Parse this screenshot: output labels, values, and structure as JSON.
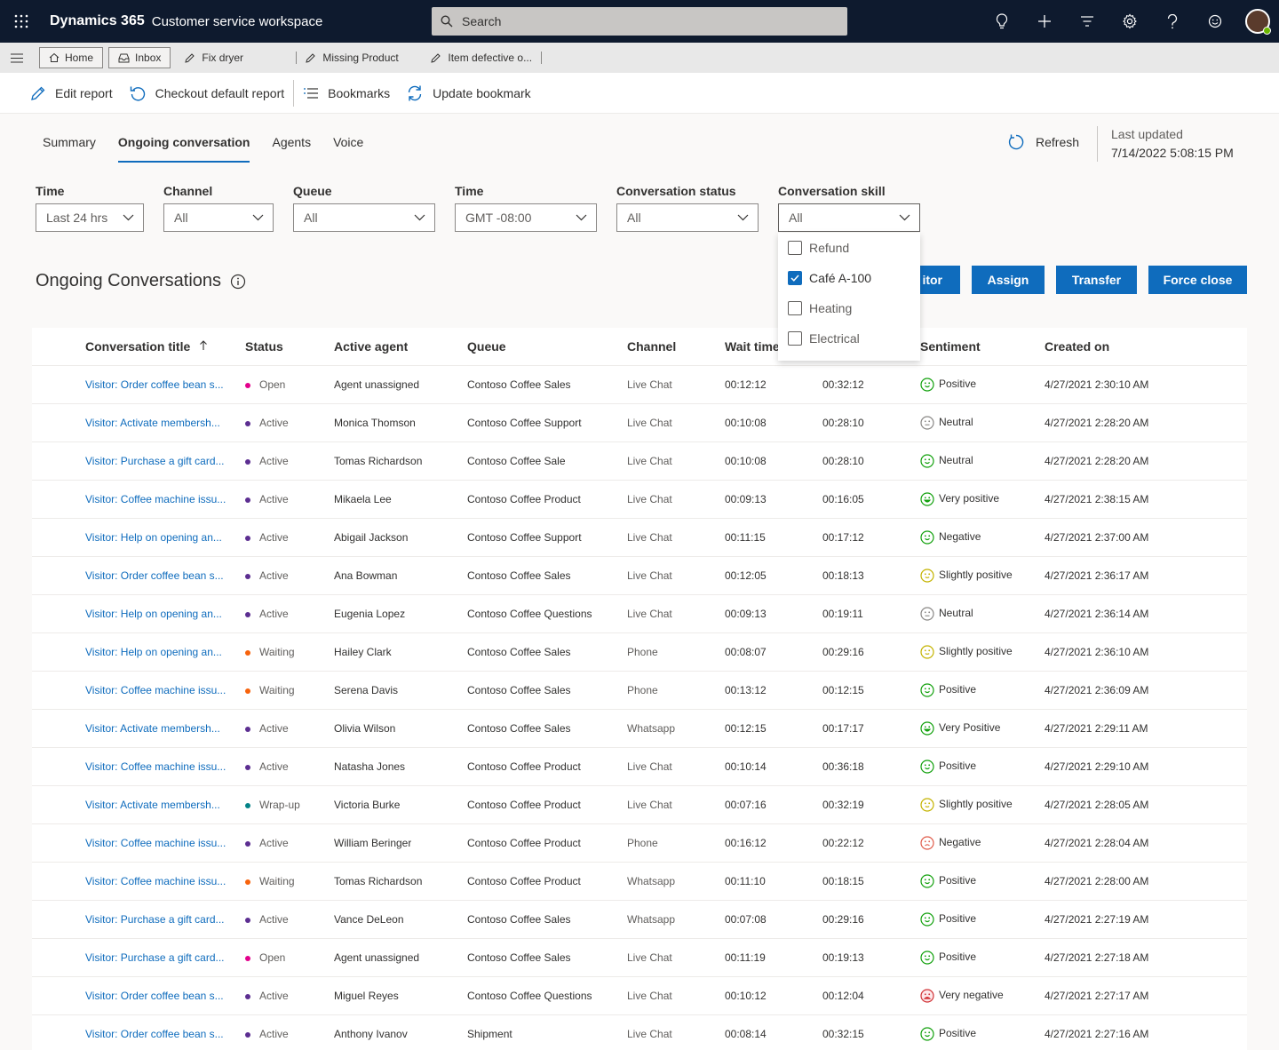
{
  "app": {
    "brand": "Dynamics 365",
    "name": "Customer service workspace"
  },
  "search": {
    "placeholder": "Search"
  },
  "session_tabs": {
    "home": "Home",
    "inbox": "Inbox",
    "sessions": [
      "Fix dryer",
      "Missing Product",
      "Item defective o..."
    ]
  },
  "commands": {
    "edit_report": "Edit report",
    "checkout_default": "Checkout default report",
    "bookmarks": "Bookmarks",
    "update_bookmark": "Update bookmark"
  },
  "pivots": [
    "Summary",
    "Ongoing conversation",
    "Agents",
    "Voice"
  ],
  "refresh": {
    "label": "Refresh",
    "last_updated_label": "Last updated",
    "last_updated_value": "7/14/2022 5:08:15 PM"
  },
  "filters": [
    {
      "label": "Time",
      "value": "Last 24 hrs"
    },
    {
      "label": "Channel",
      "value": "All"
    },
    {
      "label": "Queue",
      "value": "All"
    },
    {
      "label": "Time",
      "value": "GMT -08:00"
    },
    {
      "label": "Conversation status",
      "value": "All"
    },
    {
      "label": "Conversation skill",
      "value": "All"
    }
  ],
  "skill_options": [
    {
      "label": "Refund",
      "checked": false
    },
    {
      "label": "Café A-100",
      "checked": true
    },
    {
      "label": "Heating",
      "checked": false
    },
    {
      "label": "Electrical",
      "checked": false
    }
  ],
  "section": {
    "title": "Ongoing Conversations"
  },
  "actions": {
    "monitor": "itor",
    "assign": "Assign",
    "transfer": "Transfer",
    "force_close": "Force close"
  },
  "columns": [
    "Conversation title",
    "Status",
    "Active agent",
    "Queue",
    "Channel",
    "Wait time",
    "",
    "Sentiment",
    "Created on"
  ],
  "status_colors": {
    "Open": "#e3008c",
    "Active": "#5c2e91",
    "Waiting": "#f7630c",
    "Wrap-up": "#038387"
  },
  "sentiment_colors": {
    "positive": "#13a10e",
    "neutral": "#8a8886",
    "slight": "#c4b300",
    "negative": "#e05c4b",
    "very_negative": "#d13438"
  },
  "rows": [
    {
      "title": "Visitor: Order coffee bean s...",
      "status": "Open",
      "agent": "Agent unassigned",
      "queue": "Contoso Coffee Sales",
      "channel": "Live Chat",
      "wait": "00:12:12",
      "handle": "00:32:12",
      "sentiment": "Positive",
      "face": "positive",
      "created": "4/27/2021 2:30:10 AM"
    },
    {
      "title": "Visitor: Activate membersh...",
      "status": "Active",
      "agent": "Monica Thomson",
      "queue": "Contoso Coffee Support",
      "channel": "Live Chat",
      "wait": "00:10:08",
      "handle": "00:28:10",
      "sentiment": "Neutral",
      "face": "neutral",
      "created": "4/27/2021 2:28:20 AM"
    },
    {
      "title": "Visitor: Purchase a gift card...",
      "status": "Active",
      "agent": "Tomas Richardson",
      "queue": "Contoso Coffee Sale",
      "channel": "Live Chat",
      "wait": "00:10:08",
      "handle": "00:28:10",
      "sentiment": "Neutral",
      "face": "positive",
      "created": "4/27/2021 2:28:20 AM"
    },
    {
      "title": "Visitor: Coffee machine issu...",
      "status": "Active",
      "agent": "Mikaela Lee",
      "queue": "Contoso Coffee Product",
      "channel": "Live Chat",
      "wait": "00:09:13",
      "handle": "00:16:05",
      "sentiment": "Very positive",
      "face": "very_positive",
      "created": "4/27/2021 2:38:15 AM"
    },
    {
      "title": "Visitor: Help on opening an...",
      "status": "Active",
      "agent": "Abigail Jackson",
      "queue": "Contoso Coffee Support",
      "channel": "Live Chat",
      "wait": "00:11:15",
      "handle": "00:17:12",
      "sentiment": "Negative",
      "face": "positive",
      "created": "4/27/2021 2:37:00 AM"
    },
    {
      "title": "Visitor: Order coffee bean s...",
      "status": "Active",
      "agent": "Ana Bowman",
      "queue": "Contoso Coffee Sales",
      "channel": "Live Chat",
      "wait": "00:12:05",
      "handle": "00:18:13",
      "sentiment": "Slightly positive",
      "face": "slight",
      "created": "4/27/2021 2:36:17 AM"
    },
    {
      "title": "Visitor: Help on opening an...",
      "status": "Active",
      "agent": "Eugenia Lopez",
      "queue": "Contoso Coffee Questions",
      "channel": "Live Chat",
      "wait": "00:09:13",
      "handle": "00:19:11",
      "sentiment": "Neutral",
      "face": "neutral",
      "created": "4/27/2021 2:36:14 AM"
    },
    {
      "title": "Visitor: Help on opening an...",
      "status": "Waiting",
      "agent": "Hailey Clark",
      "queue": "Contoso Coffee Sales",
      "channel": "Phone",
      "wait": "00:08:07",
      "handle": "00:29:16",
      "sentiment": "Slightly positive",
      "face": "slight",
      "created": "4/27/2021 2:36:10 AM"
    },
    {
      "title": "Visitor: Coffee machine issu...",
      "status": "Waiting",
      "agent": "Serena Davis",
      "queue": "Contoso Coffee Sales",
      "channel": "Phone",
      "wait": "00:13:12",
      "handle": "00:12:15",
      "sentiment": "Positive",
      "face": "positive",
      "created": "4/27/2021 2:36:09 AM"
    },
    {
      "title": "Visitor: Activate membersh...",
      "status": "Active",
      "agent": "Olivia Wilson",
      "queue": "Contoso Coffee Sales",
      "channel": "Whatsapp",
      "wait": "00:12:15",
      "handle": "00:17:17",
      "sentiment": "Very Positive",
      "face": "very_positive",
      "created": "4/27/2021 2:29:11 AM"
    },
    {
      "title": "Visitor: Coffee machine issu...",
      "status": "Active",
      "agent": "Natasha Jones",
      "queue": "Contoso Coffee Product",
      "channel": "Live Chat",
      "wait": "00:10:14",
      "handle": "00:36:18",
      "sentiment": "Positive",
      "face": "positive",
      "created": "4/27/2021 2:29:10 AM"
    },
    {
      "title": "Visitor: Activate membersh...",
      "status": "Wrap-up",
      "agent": "Victoria Burke",
      "queue": "Contoso Coffee Product",
      "channel": "Live Chat",
      "wait": "00:07:16",
      "handle": "00:32:19",
      "sentiment": "Slightly positive",
      "face": "slight",
      "created": "4/27/2021 2:28:05 AM"
    },
    {
      "title": "Visitor: Coffee machine issu...",
      "status": "Active",
      "agent": "William Beringer",
      "queue": "Contoso Coffee Product",
      "channel": "Phone",
      "wait": "00:16:12",
      "handle": "00:22:12",
      "sentiment": "Negative",
      "face": "negative",
      "created": "4/27/2021 2:28:04 AM"
    },
    {
      "title": "Visitor: Coffee machine issu...",
      "status": "Waiting",
      "agent": "Tomas Richardson",
      "queue": "Contoso Coffee Product",
      "channel": "Whatsapp",
      "wait": "00:11:10",
      "handle": "00:18:15",
      "sentiment": "Positive",
      "face": "positive",
      "created": "4/27/2021 2:28:00 AM"
    },
    {
      "title": "Visitor: Purchase a gift card...",
      "status": "Active",
      "agent": "Vance DeLeon",
      "queue": "Contoso Coffee Sales",
      "channel": "Whatsapp",
      "wait": "00:07:08",
      "handle": "00:29:16",
      "sentiment": "Positive",
      "face": "positive",
      "created": "4/27/2021 2:27:19 AM"
    },
    {
      "title": "Visitor: Purchase a gift card...",
      "status": "Open",
      "agent": "Agent unassigned",
      "queue": "Contoso Coffee Sales",
      "channel": "Live Chat",
      "wait": "00:11:19",
      "handle": "00:19:13",
      "sentiment": "Positive",
      "face": "positive",
      "created": "4/27/2021 2:27:18 AM"
    },
    {
      "title": "Visitor: Order coffee bean s...",
      "status": "Active",
      "agent": "Miguel Reyes",
      "queue": "Contoso Coffee Questions",
      "channel": "Live Chat",
      "wait": "00:10:12",
      "handle": "00:12:04",
      "sentiment": "Very negative",
      "face": "very_negative",
      "created": "4/27/2021 2:27:17 AM"
    },
    {
      "title": "Visitor: Order coffee bean s...",
      "status": "Active",
      "agent": "Anthony Ivanov",
      "queue": "Shipment",
      "channel": "Live Chat",
      "wait": "00:08:14",
      "handle": "00:32:15",
      "sentiment": "Positive",
      "face": "positive",
      "created": "4/27/2021 2:27:16 AM"
    }
  ]
}
